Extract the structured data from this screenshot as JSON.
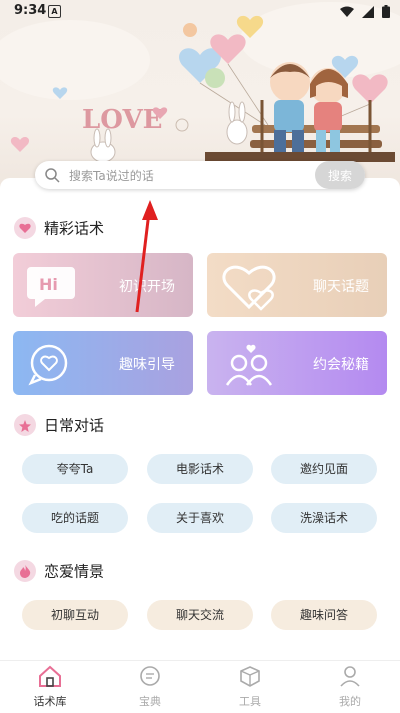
{
  "status_bar": {
    "time": "9:34",
    "notification": "A"
  },
  "search": {
    "placeholder": "搜索Ta说过的话",
    "button_label": "搜索"
  },
  "banner": {
    "text": "LOVE"
  },
  "sections": {
    "featured": {
      "title": "精彩话术",
      "cards": [
        {
          "label": "初识开场",
          "icon": "hi-icon",
          "color": "#e8c2d0"
        },
        {
          "label": "聊天话题",
          "icon": "hearts-icon",
          "color": "#ecd2ba"
        },
        {
          "label": "趣味引导",
          "icon": "heart-bubble-icon",
          "color": "#8fb5f0"
        },
        {
          "label": "约会秘籍",
          "icon": "couple-icon",
          "color": "#b88cf0"
        }
      ]
    },
    "daily": {
      "title": "日常对话",
      "tags": [
        "夸夸Ta",
        "电影话术",
        "邀约见面",
        "吃的话题",
        "关于喜欢",
        "洗澡话术"
      ]
    },
    "romance": {
      "title": "恋爱情景",
      "tags": [
        "初聊互动",
        "聊天交流",
        "趣味问答"
      ]
    }
  },
  "bottom_nav": {
    "items": [
      {
        "label": "话术库",
        "icon": "home-icon",
        "active": true
      },
      {
        "label": "宝典",
        "icon": "chat-icon",
        "active": false
      },
      {
        "label": "工具",
        "icon": "box-icon",
        "active": false
      },
      {
        "label": "我的",
        "icon": "user-icon",
        "active": false
      }
    ]
  }
}
